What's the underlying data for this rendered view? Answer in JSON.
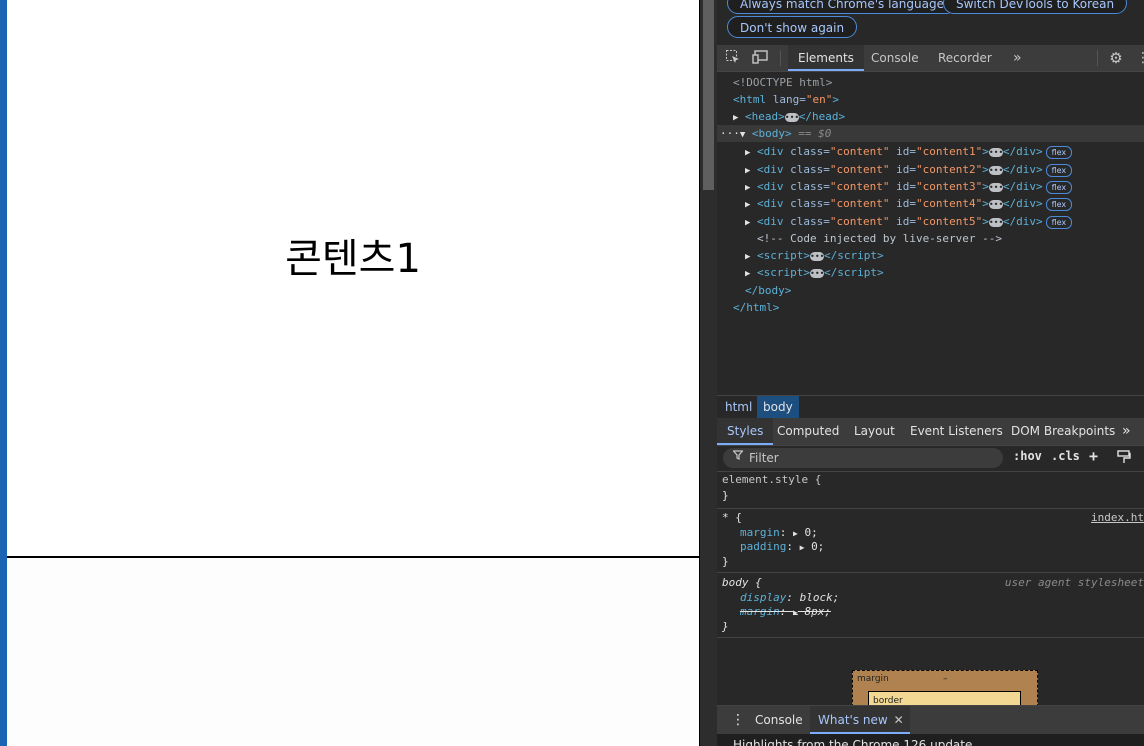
{
  "page": {
    "section1_label": "콘텐츠1"
  },
  "devtools": {
    "infobar": {
      "match_language": "Always match Chrome's language",
      "switch_language": "Switch DevTools to Korean",
      "dont_show": "Don't show again"
    },
    "tabs": {
      "elements": "Elements",
      "console": "Console",
      "recorder": "Recorder",
      "more": "»"
    },
    "dom": {
      "doctype": "<!DOCTYPE html>",
      "html_lang_attr": "lang",
      "html_lang_val": "\"en\"",
      "head": "head",
      "body": "body",
      "body_eq": "== $0",
      "div_class_val": "\"content\"",
      "div_ids": [
        "\"content1\"",
        "\"content2\"",
        "\"content3\"",
        "\"content4\"",
        "\"content5\""
      ],
      "flex_badge": "flex",
      "comment": "<!-- Code injected by live-server -->",
      "script": "script",
      "end_body": "</body>",
      "end_html": "</html>"
    },
    "breadcrumbs": [
      "html",
      "body"
    ],
    "subtabs": {
      "styles": "Styles",
      "computed": "Computed",
      "layout": "Layout",
      "event_listeners": "Event Listeners",
      "dom_breakpoints": "DOM Breakpoints",
      "more": "»"
    },
    "filter": {
      "placeholder": "Filter",
      "hov": ":hov",
      "cls": ".cls"
    },
    "styles": {
      "element_style": "element.style {",
      "close": "}",
      "star_selector": "* {",
      "star_source": "index.ht",
      "margin_prop": "margin",
      "margin_val": "0;",
      "padding_prop": "padding",
      "padding_val": "0;",
      "body_selector": "body {",
      "ua_source": "user agent stylesheet",
      "display_prop": "display",
      "display_val": "block;",
      "body_margin_prop": "margin",
      "body_margin_val": "8px;"
    },
    "boxmodel": {
      "margin_label": "margin",
      "margin_value": "–",
      "border_label": "border"
    },
    "drawer": {
      "console": "Console",
      "whats_new": "What's new",
      "highlights": "Highlights from the Chrome 126 update"
    }
  }
}
